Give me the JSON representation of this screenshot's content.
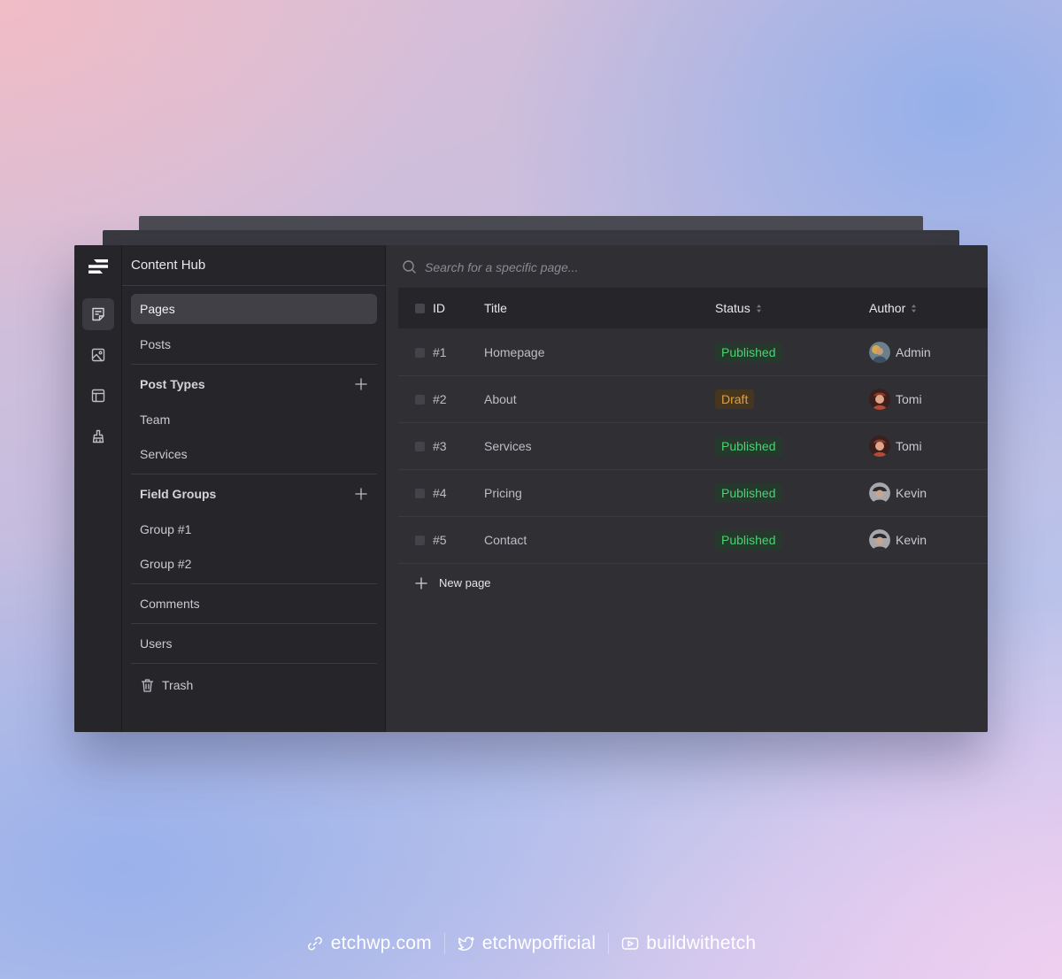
{
  "app": {
    "title": "Content Hub"
  },
  "rail": {
    "items": [
      "pages-icon",
      "media-icon",
      "layout-icon",
      "brush-icon"
    ]
  },
  "nav": {
    "pages": "Pages",
    "posts": "Posts",
    "post_types": {
      "label": "Post Types",
      "items": [
        "Team",
        "Services"
      ]
    },
    "field_groups": {
      "label": "Field Groups",
      "items": [
        "Group #1",
        "Group #2"
      ]
    },
    "comments": "Comments",
    "users": "Users",
    "trash": "Trash"
  },
  "search": {
    "placeholder": "Search for a specific page..."
  },
  "table": {
    "headers": {
      "id": "ID",
      "title": "Title",
      "status": "Status",
      "author": "Author"
    },
    "rows": [
      {
        "id": "#1",
        "title": "Homepage",
        "status": "Published",
        "author": "Admin"
      },
      {
        "id": "#2",
        "title": "About",
        "status": "Draft",
        "author": "Tomi"
      },
      {
        "id": "#3",
        "title": "Services",
        "status": "Published",
        "author": "Tomi"
      },
      {
        "id": "#4",
        "title": "Pricing",
        "status": "Published",
        "author": "Kevin"
      },
      {
        "id": "#5",
        "title": "Contact",
        "status": "Published",
        "author": "Kevin"
      }
    ],
    "new_page": "New page"
  },
  "status_colors": {
    "published": "#4fcf74",
    "draft": "#e4a038"
  },
  "footer": {
    "website": "etchwp.com",
    "twitter": "etchwpofficial",
    "youtube": "buildwithetch"
  }
}
